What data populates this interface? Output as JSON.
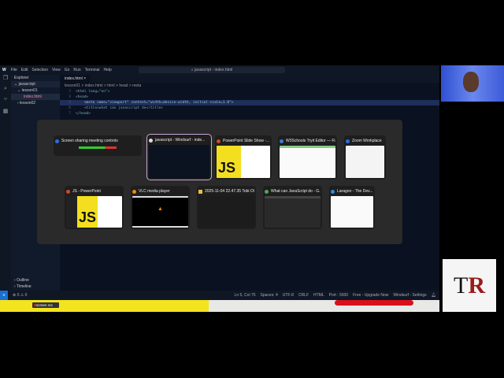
{
  "ide": {
    "menu": [
      "File",
      "Edit",
      "Selection",
      "View",
      "Go",
      "Run",
      "Terminal",
      "Help"
    ],
    "search": "javascript - index.html",
    "explorer_title": "Explorer",
    "tree": [
      {
        "label": "javascript"
      },
      {
        "label": "lesson01"
      },
      {
        "label": "index.html"
      },
      {
        "label": "lesson02"
      }
    ],
    "outline": "Outline",
    "timeline": "Timeline",
    "tab": "index.html",
    "breadcrumb": "lesson01 > index.html > html > head > meta",
    "code": [
      {
        "n": "2",
        "text": "<html lang=\"en\">"
      },
      {
        "n": "3",
        "text": "<head>"
      },
      {
        "n": "5",
        "text": "    <meta name=\"viewport\" content=\"width=device-width, initial-scale=1.0\">"
      },
      {
        "n": "6",
        "text": "    <title>what can javascript do</title>"
      },
      {
        "n": "7",
        "text": "</head>"
      }
    ],
    "status": {
      "problems": "⊗ 0 ⚠ 0",
      "position": "Ln 5, Col 75",
      "spaces": "Spaces: 4",
      "encoding": "UTF-8",
      "eol": "CRLF",
      "lang": "HTML",
      "port": "Port : 5500",
      "upgrade": "Free - Upgrade Now",
      "settings": "Windsurf - Settings"
    }
  },
  "switcher": {
    "windows": [
      {
        "title": "Screen sharing meeting controls",
        "color": "#2d6cdf"
      },
      {
        "title": "javascript - Windsurf - inde...",
        "color": "#ddd"
      },
      {
        "title": "PowerPoint Slide Show -...",
        "color": "#d04a2a"
      },
      {
        "title": "W3Schools Tryit Editor — Fi...",
        "color": "#3b7bd6"
      },
      {
        "title": "Zoom Workplace",
        "color": "#2d6cdf"
      },
      {
        "title": "JS - PowerPoint",
        "color": "#d04a2a"
      },
      {
        "title": "VLC media player",
        "color": "#f08a00"
      },
      {
        "title": "2025-11-04 22.47.35 Tobi Ol...",
        "color": "#e8c040"
      },
      {
        "title": "What can JavaScript do - G...",
        "color": "#4caf50"
      },
      {
        "title": "Laragon - The Dev...",
        "color": "#2a8ee0"
      }
    ],
    "js_label": "JS"
  },
  "recorder": "screen rec",
  "logo": {
    "text": "TR"
  }
}
